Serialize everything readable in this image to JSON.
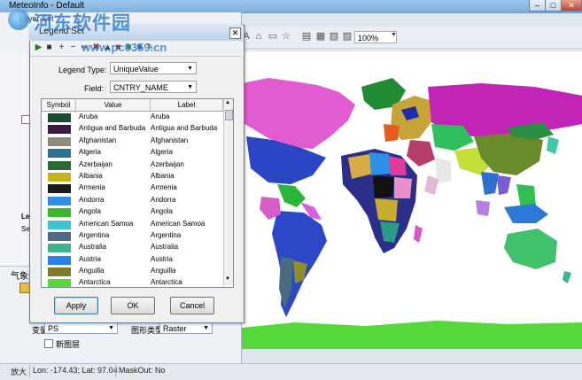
{
  "window": {
    "title": "MeteoInfo - Default",
    "min": "–",
    "max": "□",
    "close": "✕"
  },
  "toolbar": {
    "zoom": "100%"
  },
  "layer_panel": {
    "subtitle": "Layer Set",
    "label_1": "Le",
    "label_2": "Se"
  },
  "bottom_panel": {
    "title": "气象数",
    "var_label": "变量",
    "var_value": "PS",
    "graph_label": "图形类型",
    "graph_value": "Raster",
    "new_layer_label": "新图层"
  },
  "legend_dialog": {
    "title": "Legend Set",
    "close": "✕",
    "legend_type_label": "Legend Type:",
    "legend_type_value": "UniqueValue",
    "field_label": "Field:",
    "field_value": "CNTRY_NAME",
    "columns": [
      "Symbol",
      "Value",
      "Label"
    ],
    "rows": [
      {
        "value": "Aruba",
        "label": "Aruba",
        "color": "#1e4a34"
      },
      {
        "value": "Antigua and Barbuda",
        "label": "Antigua and Barbuda",
        "color": "#3d1a44"
      },
      {
        "value": "Afghanistan",
        "label": "Afghanistan",
        "color": "#8f8b7a"
      },
      {
        "value": "Algeria",
        "label": "Algeria",
        "color": "#2f6f8f"
      },
      {
        "value": "Azerbaijan",
        "label": "Azerbaijan",
        "color": "#2a6a36"
      },
      {
        "value": "Albania",
        "label": "Albania",
        "color": "#c6b41f"
      },
      {
        "value": "Armenia",
        "label": "Armenia",
        "color": "#1b1b1b"
      },
      {
        "value": "Andorra",
        "label": "Andorra",
        "color": "#2f8ee6"
      },
      {
        "value": "Angola",
        "label": "Angola",
        "color": "#3cb82e"
      },
      {
        "value": "American Samoa",
        "label": "American Samoa",
        "color": "#3fc2d2"
      },
      {
        "value": "Argentina",
        "label": "Argentina",
        "color": "#4f6a82"
      },
      {
        "value": "Australia",
        "label": "Australia",
        "color": "#3fb38f"
      },
      {
        "value": "Austria",
        "label": "Austria",
        "color": "#2a82e8"
      },
      {
        "value": "Anguilla",
        "label": "Anguilla",
        "color": "#7e7a2a"
      },
      {
        "value": "Antarctica",
        "label": "Antarctica",
        "color": "#55d93a"
      }
    ],
    "apply_label": "Apply",
    "ok_label": "OK",
    "cancel_label": "Cancel"
  },
  "status": {
    "mode": "放大",
    "coords": "Lon: -174.43; Lat: 97.04",
    "mask": "MaskOut: No"
  },
  "watermark": {
    "text": "河东软件园",
    "url": "www.pc0359.cn"
  }
}
